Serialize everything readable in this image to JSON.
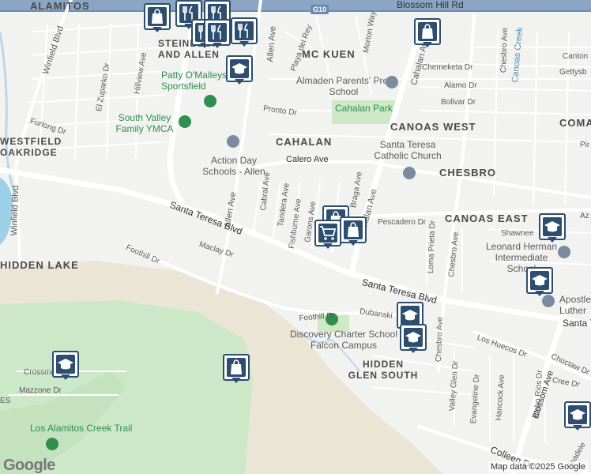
{
  "map": {
    "attribution": "Map data ©2025 Google",
    "logo": "Google",
    "highway_shield": "G10",
    "neighborhoods": [
      {
        "id": "alamitos",
        "text": "ALAMITOS"
      },
      {
        "id": "steinbeck",
        "text": "STEINBECK AND ALLEN"
      },
      {
        "id": "mckuen",
        "text": "MC KUEN"
      },
      {
        "id": "canoas-west",
        "text": "CANOAS WEST"
      },
      {
        "id": "cahalan",
        "text": "CAHALAN"
      },
      {
        "id": "chesbro",
        "text": "CHESBRO"
      },
      {
        "id": "canoas-east",
        "text": "CANOAS EAST"
      },
      {
        "id": "westfield-oakridge",
        "text": "WESTFIELD OAKRIDGE"
      },
      {
        "id": "hidden-lake",
        "text": "HIDDEN LAKE"
      },
      {
        "id": "hidden-glen-south",
        "text": "HIDDEN GLEN SOUTH"
      },
      {
        "id": "coma",
        "text": "COMA"
      }
    ],
    "pois": [
      {
        "id": "patty-omalleys",
        "text": "Patty O'Malleys Sportsfield",
        "color": "#2f8f4e"
      },
      {
        "id": "south-valley-ymca",
        "text": "South Valley Family YMCA",
        "color": "#2f8f4e"
      },
      {
        "id": "almaden-parents",
        "text": "Almaden Parents' Pre-School",
        "color": "#5b5b5b"
      },
      {
        "id": "cahalan-park",
        "text": "Cahalan Park",
        "color": "#2f8f4e"
      },
      {
        "id": "santa-teresa-church",
        "text": "Santa Teresa Catholic Church",
        "color": "#5b5b5b"
      },
      {
        "id": "action-day",
        "text": "Action Day Schools - Allen",
        "color": "#5b5b5b"
      },
      {
        "id": "leonard-herman",
        "text": "Leonard Herman Intermediate School",
        "color": "#5b5b5b"
      },
      {
        "id": "discovery-charter",
        "text": "Discovery Charter School Falcon Campus",
        "color": "#5b5b5b"
      },
      {
        "id": "los-alamitos-trail",
        "text": "Los Alamitos Creek Trail",
        "color": "#2f8f4e"
      },
      {
        "id": "apostles-lutheran",
        "text": "Apostles Luther",
        "color": "#5b5b5b"
      }
    ],
    "streets": [
      {
        "id": "blossom-hill-rd",
        "text": "Blossom Hill Rd"
      },
      {
        "id": "winfield-blvd-1",
        "text": "Winfield Blvd"
      },
      {
        "id": "winfield-blvd-2",
        "text": "Winfield Blvd"
      },
      {
        "id": "el-zuparko",
        "text": "El Zuparko Dr"
      },
      {
        "id": "hillview",
        "text": "Hillview Ave"
      },
      {
        "id": "furlong",
        "text": "Furlong Dr"
      },
      {
        "id": "allen-ave-1",
        "text": "Allen Ave"
      },
      {
        "id": "allen-ave-2",
        "text": "Allen Ave"
      },
      {
        "id": "playa-del-rey",
        "text": "Playa del Rey"
      },
      {
        "id": "morton-way",
        "text": "Morton Way"
      },
      {
        "id": "cahalan-ave-1",
        "text": "Cahalan Ave"
      },
      {
        "id": "cahalan-ave-2",
        "text": "Cahalan Ave"
      },
      {
        "id": "chesbro-ave-1",
        "text": "Chesbro Ave"
      },
      {
        "id": "chesbro-ave-2",
        "text": "Chesbro Ave"
      },
      {
        "id": "chesbro-ave-3",
        "text": "Chesbro Ave"
      },
      {
        "id": "canoas-creek",
        "text": "Canoas Creek"
      },
      {
        "id": "chemeketa",
        "text": "Chemeketa Dr"
      },
      {
        "id": "alamo",
        "text": "Alamo Dr"
      },
      {
        "id": "bolivar",
        "text": "Bolivar Dr"
      },
      {
        "id": "canton",
        "text": "Canton"
      },
      {
        "id": "gettysb",
        "text": "Gettysb"
      },
      {
        "id": "pronto",
        "text": "Pronto Dr"
      },
      {
        "id": "calero",
        "text": "Calero Ave"
      },
      {
        "id": "cabral",
        "text": "Cabral Ave"
      },
      {
        "id": "tandera",
        "text": "Tandera Ave"
      },
      {
        "id": "fishburne",
        "text": "Fishburne Ave"
      },
      {
        "id": "garons",
        "text": "Garons Ave"
      },
      {
        "id": "braga",
        "text": "Braga Ave"
      },
      {
        "id": "pescadero",
        "text": "Pescadero Dr"
      },
      {
        "id": "loma-prieta",
        "text": "Loma Prieta Dr"
      },
      {
        "id": "shawnee",
        "text": "Shawnee"
      },
      {
        "id": "az",
        "text": "Az"
      },
      {
        "id": "pir",
        "text": "Pir"
      },
      {
        "id": "santa-teresa-1",
        "text": "Santa Teresa Blvd"
      },
      {
        "id": "santa-teresa-2",
        "text": "Santa Teresa Blvd"
      },
      {
        "id": "santa-teresa-3",
        "text": "Santa Te"
      },
      {
        "id": "foothill-1",
        "text": "Foothill Dr"
      },
      {
        "id": "foothill-2",
        "text": "Foothill Dr"
      },
      {
        "id": "maclay",
        "text": "Maclay Dr"
      },
      {
        "id": "dubanski",
        "text": "Dubanski"
      },
      {
        "id": "los-huecos",
        "text": "Los Huecos Dr"
      },
      {
        "id": "choctaw",
        "text": "Choctaw Dr"
      },
      {
        "id": "blossom-ave",
        "text": "Blossom Ave"
      },
      {
        "id": "cree",
        "text": "Cree Dr"
      },
      {
        "id": "valley-glen",
        "text": "Valley Glen Dr"
      },
      {
        "id": "evangeline",
        "text": "Evangeline Dr"
      },
      {
        "id": "hancock",
        "text": "Hancock Ave"
      },
      {
        "id": "ocho-rios",
        "text": "Ocho Rios Dr"
      },
      {
        "id": "crossmoor",
        "text": "Crossmoor"
      },
      {
        "id": "mazzone",
        "text": "Mazzone Dr"
      },
      {
        "id": "es",
        "text": "ES"
      },
      {
        "id": "colleen",
        "text": "Colleen Dr"
      },
      {
        "id": "shadele",
        "text": "Shadele"
      }
    ]
  }
}
